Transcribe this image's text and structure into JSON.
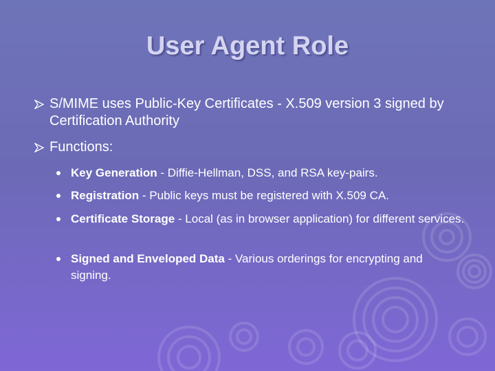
{
  "slide": {
    "title": "User Agent Role",
    "bullets": [
      {
        "text": "S/MIME uses Public-Key Certificates - X.509 version 3 signed by Certification Authority"
      },
      {
        "text": "Functions:"
      }
    ],
    "sub_bullets": [
      {
        "term": "Key Generation",
        "desc": " - Diffie-Hellman, DSS, and RSA key-pairs."
      },
      {
        "term": "Registration",
        "desc": " -  Public keys must be registered with X.509 CA."
      },
      {
        "term": "Certificate Storage",
        "desc": " - Local (as in browser application) for different services."
      },
      {
        "term": "Signed and Enveloped Data",
        "desc": " - Various orderings for encrypting and signing."
      }
    ]
  },
  "colors": {
    "background_top": "#6e74b8",
    "background_bottom": "#7f67d6",
    "title": "#d4d4f2",
    "text": "#ffffff"
  },
  "icons": {
    "level1_marker": "arrow-bullet-icon",
    "level2_marker": "dot-bullet-icon"
  }
}
